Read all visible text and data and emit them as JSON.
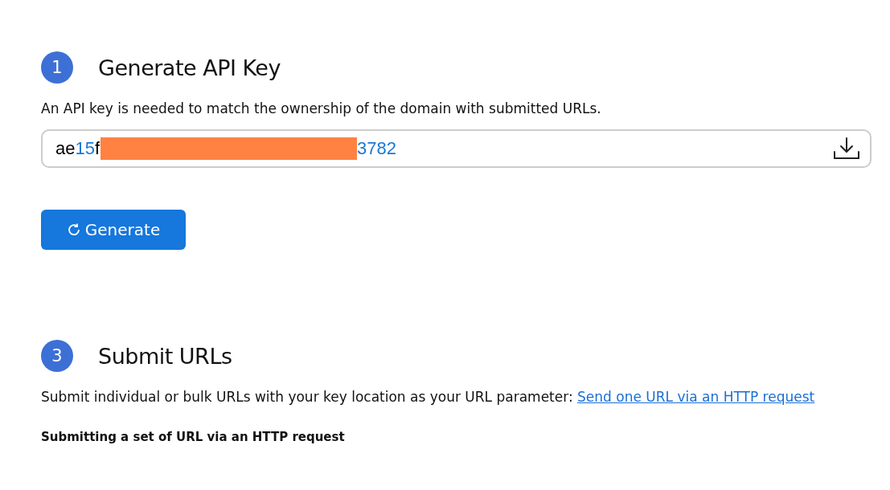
{
  "sections": [
    {
      "number": "1",
      "title": "Generate API Key",
      "description": "An API key is needed to match the ownership of the domain with submitted URLs.",
      "key_field": {
        "segments": [
          {
            "kind": "letters",
            "text": "ae"
          },
          {
            "kind": "digits",
            "text": "15"
          },
          {
            "kind": "letters",
            "text": "f"
          },
          {
            "kind": "redacted"
          },
          {
            "kind": "digits",
            "text": "3782"
          }
        ]
      },
      "button": {
        "label": "Generate"
      }
    },
    {
      "number": "3",
      "title": "Submit URLs",
      "description": "Submit individual or bulk URLs with your key location as your URL parameter: ",
      "link": "Send one URL via an HTTP request",
      "subheading": "Submitting a set of URL via an HTTP request"
    }
  ]
}
